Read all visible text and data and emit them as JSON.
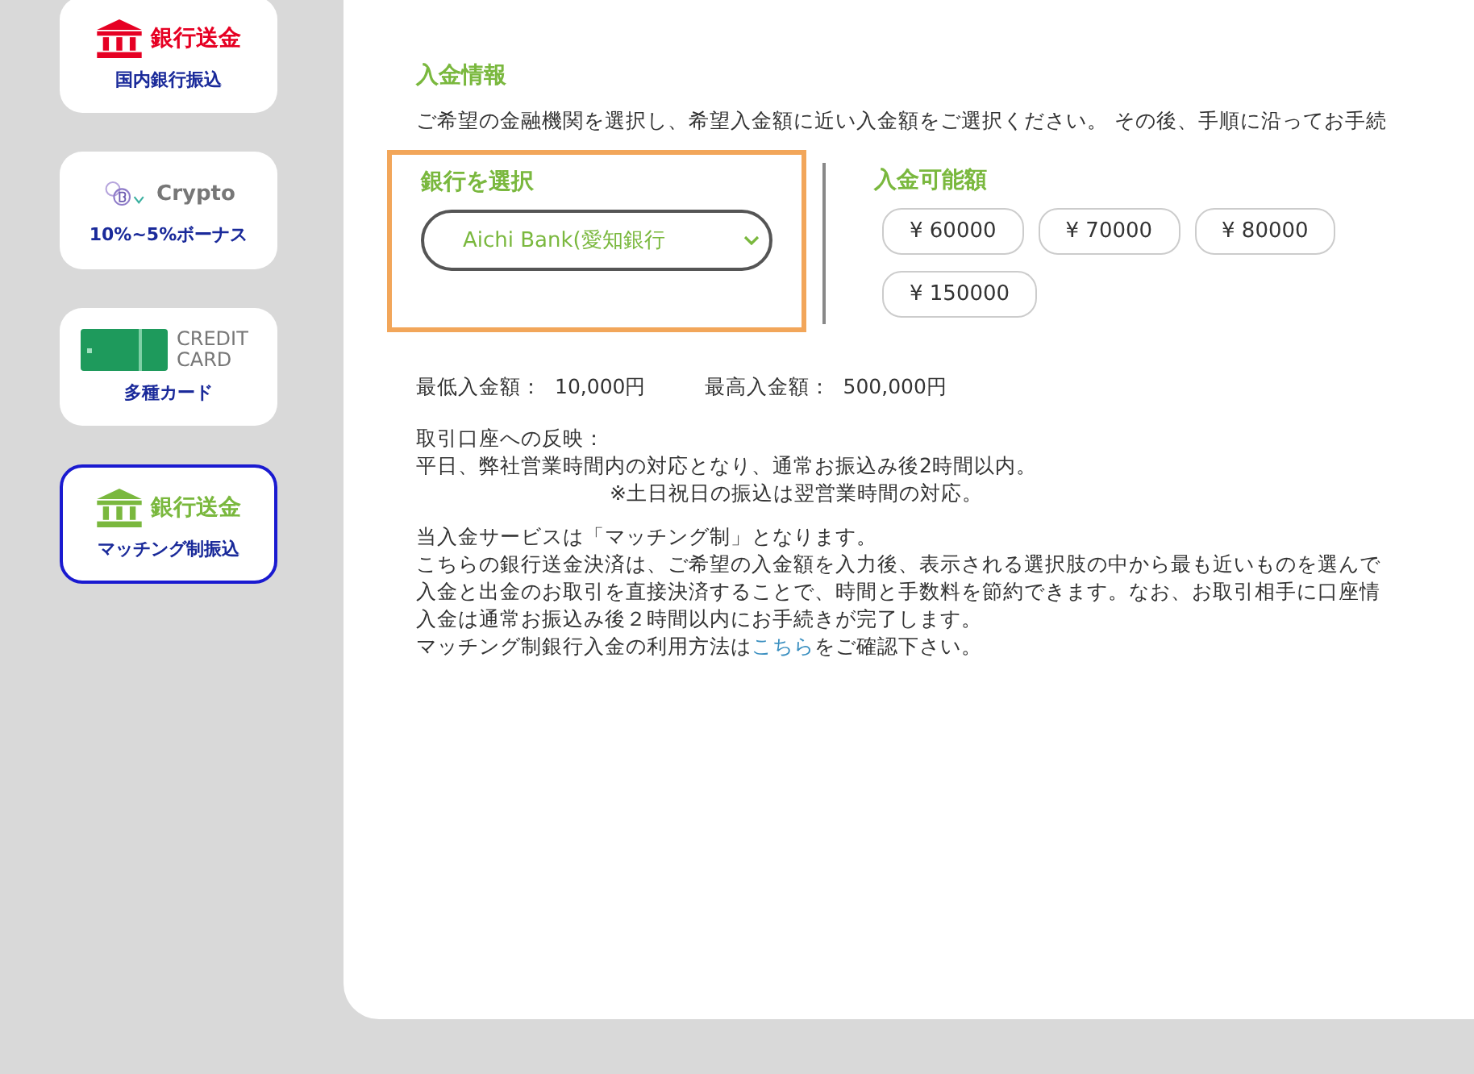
{
  "sidebar": {
    "items": [
      {
        "kind": "bank",
        "title": "銀行送金",
        "subtitle": "国内銀行振込",
        "color": "#e60023",
        "selected": false
      },
      {
        "kind": "crypto",
        "title": "Crypto",
        "subtitle": "10%~5%ボーナス",
        "color": "#777777",
        "selected": false
      },
      {
        "kind": "card",
        "title": "CREDIT CARD",
        "subtitle": "多種カード",
        "color": "#777777",
        "selected": false
      },
      {
        "kind": "bank",
        "title": "銀行送金",
        "subtitle": "マッチング制振込",
        "color": "#7ab83e",
        "selected": true
      }
    ]
  },
  "deposit": {
    "heading": "入金情報",
    "intro": "ご希望の金融機関を選択し、希望入金額に近い入金額をご選択ください。 その後、手順に沿ってお手続",
    "bank_select": {
      "label": "銀行を選択",
      "value": "Aichi Bank(愛知銀行",
      "highlighted": true
    },
    "amounts": {
      "label": "入金可能額",
      "options": [
        "¥ 60000",
        "¥ 70000",
        "¥ 80000",
        "¥ 150000"
      ]
    },
    "limits": [
      {
        "label": "最低入金額：",
        "value": "10,000円"
      },
      {
        "label": "最高入金額：",
        "value": "500,000円"
      }
    ],
    "reflection": {
      "label": "取引口座への反映：",
      "lines": [
        "平日、弊社営業時間内の対応となり、通常お振込み後2時間以内。",
        "※土日祝日の振込は翌営業時間の対応。"
      ]
    },
    "notes": [
      "当入金サービスは「マッチング制」となります。",
      "こちらの銀行送金決済は、ご希望の入金額を入力後、表示される選択肢の中から最も近いものを選んで",
      "入金と出金のお取引を直接決済することで、時間と手数料を節約できます。なお、お取引相手に口座情",
      "入金は通常お振込み後２時間以内にお手続きが完了します。"
    ],
    "guide": {
      "before": "マッチング制銀行入金の利用方法は",
      "link": "こちら",
      "after": "をご確認下さい。"
    }
  }
}
